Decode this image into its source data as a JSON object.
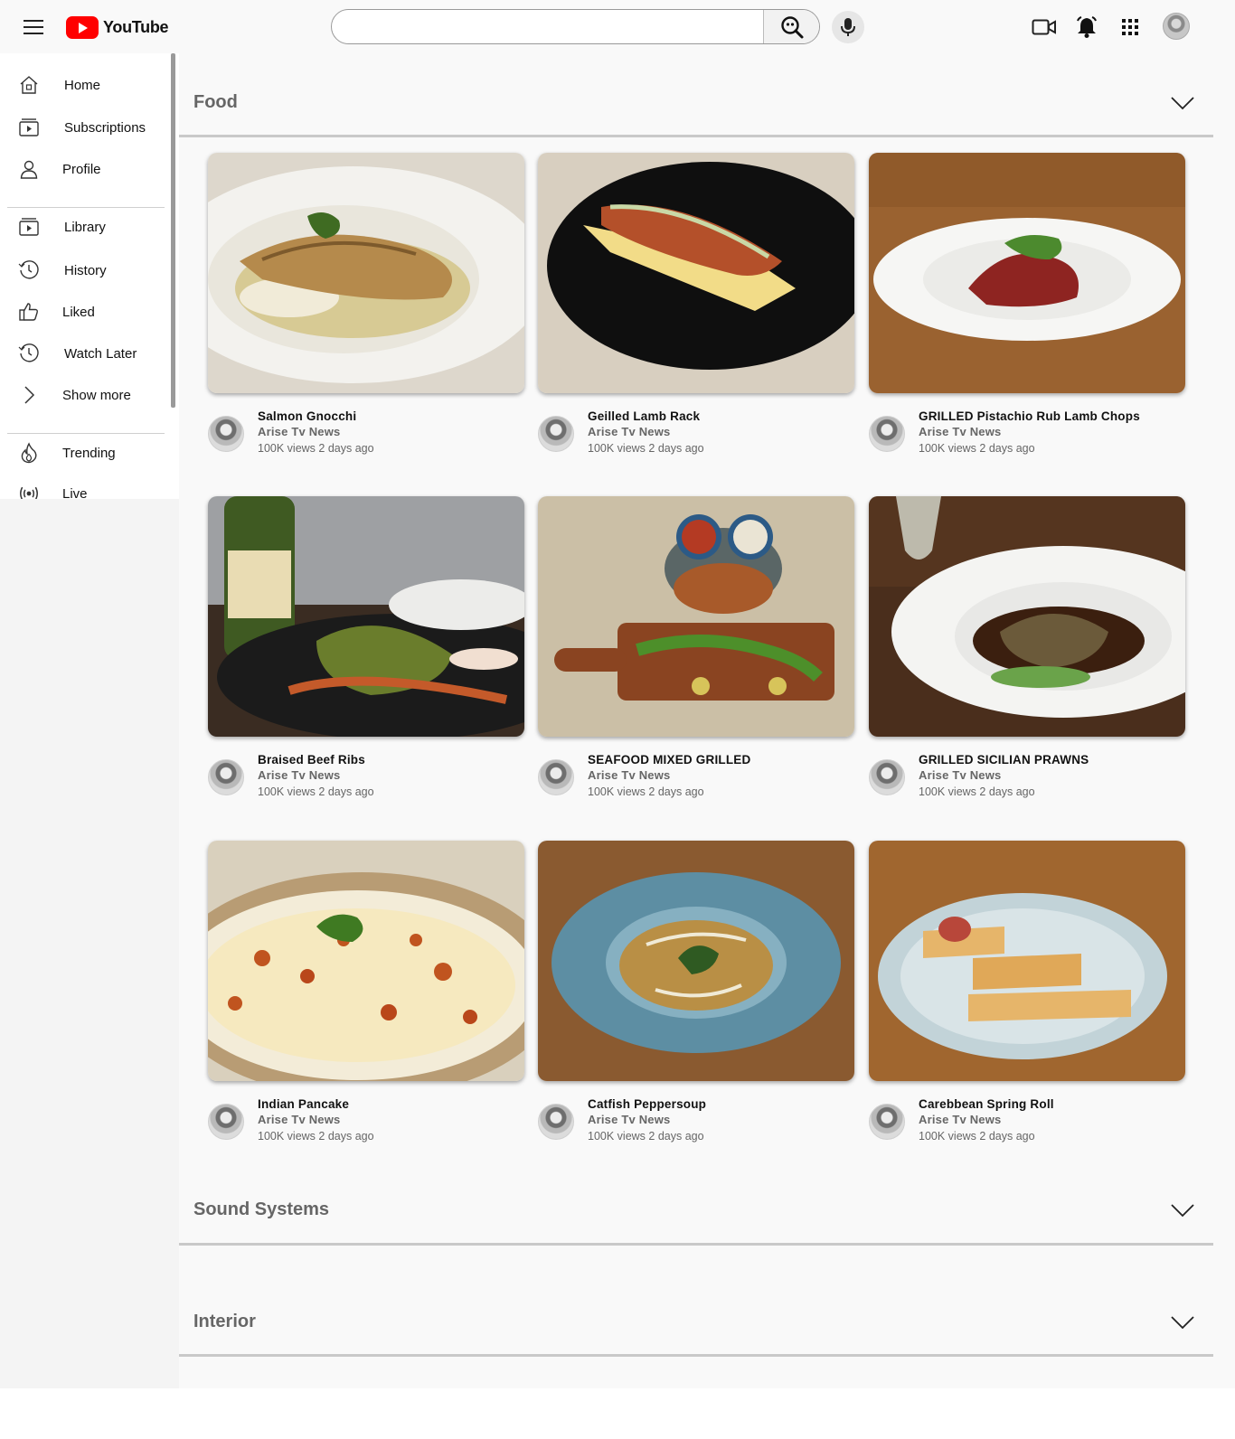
{
  "header": {
    "logo_text": "YouTube",
    "search_placeholder": "",
    "icons": [
      "menu-icon",
      "search-icon",
      "mic-icon",
      "video-camera-icon",
      "bell-icon",
      "apps-grid-icon",
      "account-avatar"
    ]
  },
  "sidebar": {
    "items": [
      {
        "label": "Home",
        "icon": "home-icon"
      },
      {
        "label": "Subscriptions",
        "icon": "subscriptions-icon"
      },
      {
        "label": "Profile",
        "icon": "profile-icon"
      },
      {
        "label": "Library",
        "icon": "library-icon"
      },
      {
        "label": "History",
        "icon": "history-icon"
      },
      {
        "label": "Liked",
        "icon": "thumbs-up-icon"
      },
      {
        "label": "Watch Later",
        "icon": "clock-icon"
      },
      {
        "label": "Show more",
        "icon": "chevron-right-icon"
      },
      {
        "label": "Trending",
        "icon": "flame-icon"
      },
      {
        "label": "Live",
        "icon": "broadcast-icon"
      }
    ]
  },
  "sections": [
    {
      "title": "Food",
      "videos": [
        {
          "title": "Salmon Gnocchi",
          "channel": "Arise Tv News",
          "meta": "100K views 2 days ago"
        },
        {
          "title": "Geilled Lamb Rack",
          "channel": "Arise Tv News",
          "meta": "100K views 2 days ago"
        },
        {
          "title": "GRILLED Pistachio Rub Lamb Chops",
          "channel": "Arise Tv News",
          "meta": "100K views 2 days ago"
        },
        {
          "title": "Braised Beef Ribs",
          "channel": "Arise Tv News",
          "meta": "100K views 2 days ago"
        },
        {
          "title": "SEAFOOD MIXED GRILLED",
          "channel": "Arise Tv News",
          "meta": "100K views 2 days ago"
        },
        {
          "title": "GRILLED SICILIAN PRAWNS",
          "channel": "Arise Tv News",
          "meta": "100K views 2 days ago"
        },
        {
          "title": "Indian Pancake",
          "channel": "Arise Tv News",
          "meta": "100K views 2 days ago"
        },
        {
          "title": "Catfish Peppersoup",
          "channel": "Arise Tv News",
          "meta": "100K views 2 days ago"
        },
        {
          "title": "Carebbean Spring Roll",
          "channel": "Arise Tv News",
          "meta": "100K views 2 days ago"
        }
      ]
    },
    {
      "title": "Sound Systems"
    },
    {
      "title": "Interior"
    }
  ]
}
